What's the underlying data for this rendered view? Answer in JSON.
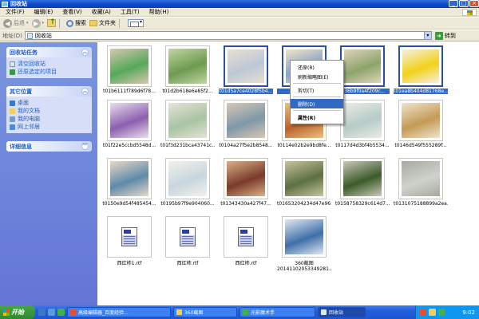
{
  "window": {
    "title": "回收站"
  },
  "menu": [
    "文件(F)",
    "编辑(E)",
    "查看(V)",
    "收藏(A)",
    "工具(T)",
    "帮助(H)"
  ],
  "toolbar": {
    "back": "后退",
    "search": "搜索",
    "folders": "文件夹"
  },
  "address": {
    "label": "地址(D)",
    "value": "回收站",
    "go": "转到"
  },
  "sidebar": {
    "tasks": {
      "title": "回收站任务",
      "items": [
        "清空回收站",
        "还原选定的项目"
      ]
    },
    "places": {
      "title": "其它位置",
      "items": [
        "桌面",
        "我的文档",
        "我的电脑",
        "网上邻居"
      ]
    },
    "details": {
      "title": "详细信息"
    }
  },
  "items": [
    {
      "label": "t01b6111f789d6f78...",
      "selected": false,
      "colors": [
        "#56a85b",
        "#d7c7b0"
      ]
    },
    {
      "label": "t01d2b618e6e85f2...",
      "selected": false,
      "colors": [
        "#6f9a4f",
        "#bfd6a3"
      ]
    },
    {
      "label": "t01d5a7ce4028f5b4...",
      "selected": true,
      "colors": [
        "#bcc8d6",
        "#e8dfcf"
      ]
    },
    {
      "label": "t01d...",
      "selected": true,
      "colors": [
        "#8aa3c4",
        "#f0e4c8"
      ]
    },
    {
      "label": "...36b9f0a4f209c...",
      "selected": true,
      "colors": [
        "#8ca46a",
        "#e1d3bc"
      ]
    },
    {
      "label": "t01ea8b404d81768e...",
      "selected": true,
      "colors": [
        "#f2d21a",
        "#f6efe3"
      ]
    },
    {
      "label": "t01f22e5ccbd5548d...",
      "selected": false,
      "colors": [
        "#8c5fae",
        "#e9ddef"
      ]
    },
    {
      "label": "t01f3d231bca43741c...",
      "selected": false,
      "colors": [
        "#a8c4a2",
        "#e6e2d8"
      ]
    },
    {
      "label": "t0104a27f5e2b8548...",
      "selected": false,
      "colors": [
        "#7e98a9",
        "#d8c7b4"
      ]
    },
    {
      "label": "t0114e02b2e9bd8fe...",
      "selected": false,
      "colors": [
        "#b8622e",
        "#efc17b"
      ]
    },
    {
      "label": "t0117d4d3bf4b5534...",
      "selected": false,
      "colors": [
        "#b7cbc8",
        "#e9ece3"
      ]
    },
    {
      "label": "t0146d549f555289f...",
      "selected": false,
      "colors": [
        "#c49a55",
        "#efe4cc"
      ]
    },
    {
      "label": "t0150e9d54f485454...",
      "selected": false,
      "colors": [
        "#5f8aa8",
        "#e8d8c8"
      ]
    },
    {
      "label": "t0195b97f9e904060...",
      "selected": false,
      "colors": [
        "#c7d6de",
        "#f2f1ec"
      ]
    },
    {
      "label": "t01343430a427f47...",
      "selected": false,
      "colors": [
        "#7a3a2a",
        "#d9b08a"
      ]
    },
    {
      "label": "t01653204234d47e96...",
      "selected": false,
      "colors": [
        "#5c7040",
        "#c7c3a0"
      ]
    },
    {
      "label": "t0158758329c614d7...",
      "selected": false,
      "colors": [
        "#3d5a2a",
        "#c8c9b8"
      ]
    },
    {
      "label": "t0131075188899a2ea...",
      "selected": false,
      "colors": [
        "#cfd2cc",
        "#a7a8a2"
      ]
    },
    {
      "label": "西红柿1.rtf",
      "type": "doc"
    },
    {
      "label": "西红柿.rtf",
      "type": "doc"
    },
    {
      "label": "西红柿.rtf",
      "type": "doc"
    },
    {
      "label": "360截图\n20141102053349281...",
      "type": "screenshot",
      "colors": [
        "#3f6fa8",
        "#dfe8f2"
      ]
    }
  ],
  "context_menu": {
    "items": [
      "还原(R)",
      "刷新缩略图(E)",
      "剪切(T)",
      "删除(D)",
      "属性(R)"
    ],
    "highlighted": "删除(D)"
  },
  "taskbar": {
    "start": "开始",
    "tasks": [
      {
        "label": "高级编辑器_百度经验...",
        "active": false,
        "color": "#e94b35"
      },
      {
        "label": "360截图",
        "active": false,
        "color": "#f1cf5c"
      },
      {
        "label": "光影魔术手",
        "active": false,
        "color": "#43b04a"
      },
      {
        "label": "回收站",
        "active": true,
        "color": "#dce7f2"
      }
    ],
    "clock": "9:02"
  },
  "accent": "#316ac5"
}
